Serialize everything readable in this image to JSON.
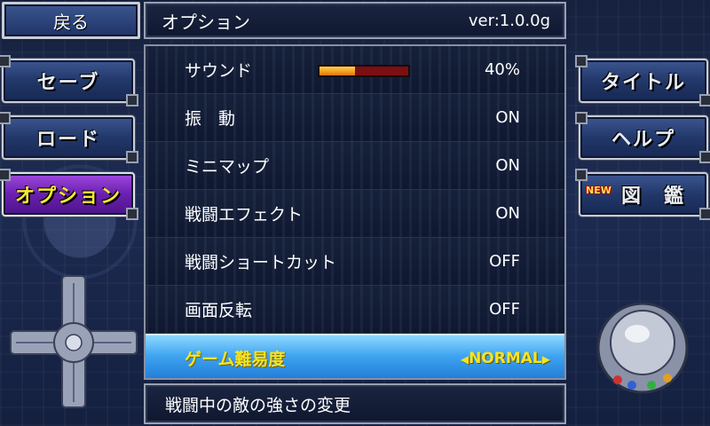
{
  "header": {
    "back_label": "戻る",
    "title": "オプション",
    "version": "ver:1.0.0g"
  },
  "left_menu": {
    "save": "セーブ",
    "load": "ロード",
    "option": "オプション"
  },
  "right_menu": {
    "title": "タイトル",
    "help": "ヘルプ",
    "encyclopedia": "図　鑑",
    "new_badge": "NEW"
  },
  "options": {
    "sound": {
      "label": "サウンド",
      "value": "40%",
      "level": 0.4
    },
    "vibration": {
      "label": "振　動",
      "value": "ON"
    },
    "minimap": {
      "label": "ミニマップ",
      "value": "ON"
    },
    "battle_effect": {
      "label": "戦闘エフェクト",
      "value": "ON"
    },
    "battle_shortcut": {
      "label": "戦闘ショートカット",
      "value": "OFF"
    },
    "screen_flip": {
      "label": "画面反転",
      "value": "OFF"
    },
    "difficulty": {
      "label": "ゲーム難易度",
      "value": "NORMAL"
    }
  },
  "footer": {
    "description": "戦闘中の敵の強さの変更"
  },
  "colors": {
    "selected_row": "#3fa4f0",
    "highlight_text": "#f4e422",
    "active_button": "#6a1fb0"
  }
}
